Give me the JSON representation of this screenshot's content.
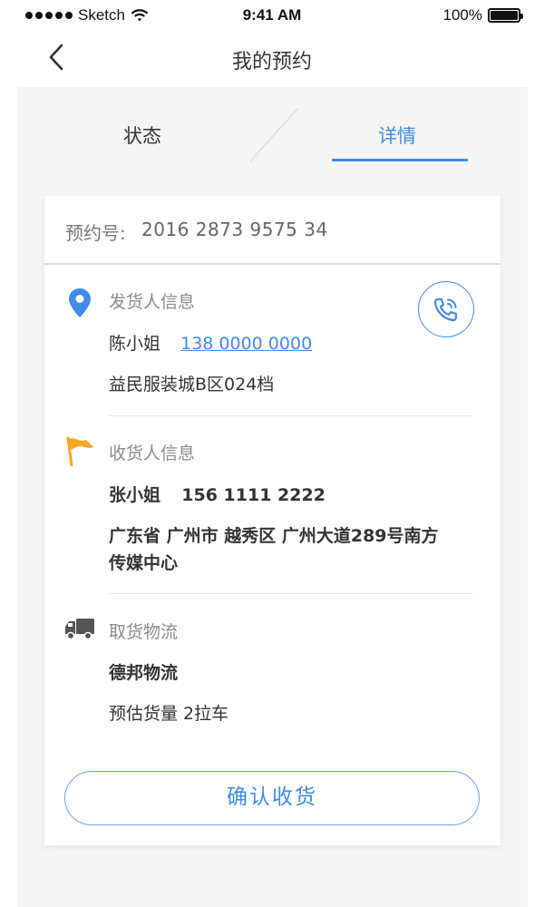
{
  "status_bar": {
    "carrier": "Sketch",
    "time": "9:41 AM",
    "battery": "100%"
  },
  "nav": {
    "title": "我的预约",
    "back_icon": "chevron-left-icon"
  },
  "tabs": [
    {
      "label": "状态",
      "active": false
    },
    {
      "label": "详情",
      "active": true
    }
  ],
  "order": {
    "label": "预约号:",
    "number": "2016 2873 9575 34"
  },
  "sender": {
    "icon": "location-pin-icon",
    "title": "发货人信息",
    "name": "陈小姐",
    "phone": "138 0000 0000",
    "address": "益民服装城B区024档",
    "call_icon": "phone-call-icon"
  },
  "receiver": {
    "icon": "flag-icon",
    "title": "收货人信息",
    "name": "张小姐",
    "phone": "156 1111 2222",
    "address_line1": "广东省 广州市 越秀区 广州大道289号南方",
    "address_line2": "传媒中心"
  },
  "logistics": {
    "icon": "truck-icon",
    "title": "取货物流",
    "company": "德邦物流",
    "estimate": "预估货量 2拉车"
  },
  "actions": {
    "confirm_label": "确认收货"
  },
  "colors": {
    "accent": "#3f8be8",
    "flag": "#f5a623",
    "truck": "#555555"
  }
}
